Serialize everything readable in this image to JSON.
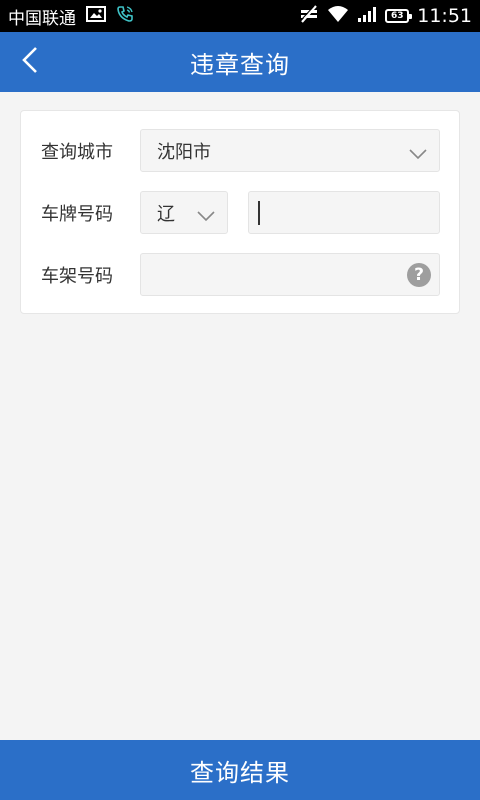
{
  "status_bar": {
    "carrier": "中国联通",
    "battery": "63",
    "time": "11:51",
    "icons": [
      "picture-icon",
      "phone-call-icon",
      "mute-icon",
      "wifi-icon",
      "signal-icon",
      "battery-icon"
    ]
  },
  "header": {
    "title": "违章查询",
    "back_icon": "chevron-left-icon"
  },
  "form": {
    "city_label": "查询城市",
    "city_value": "沈阳市",
    "plate_label": "车牌号码",
    "plate_prefix": "辽",
    "plate_number": "",
    "vin_label": "车架号码",
    "vin_value": "",
    "help_symbol": "?"
  },
  "footer": {
    "submit_label": "查询结果"
  },
  "colors": {
    "primary": "#2b6fc8",
    "background": "#f4f4f4",
    "field_bg": "#f5f5f5"
  }
}
